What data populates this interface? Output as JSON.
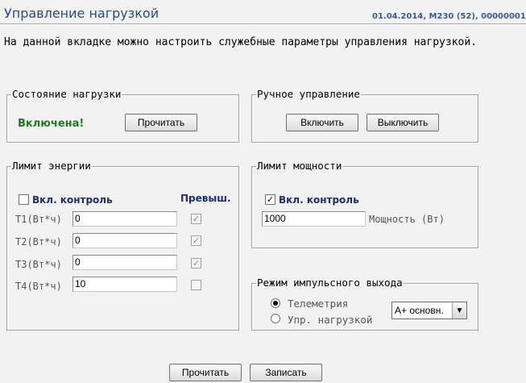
{
  "header": {
    "title": "Управление нагрузкой",
    "info": "01.04.2014, M230 (52), 00000001"
  },
  "description": "На данной вкладке можно настроить служебные параметры управления нагрузкой.",
  "load_state": {
    "legend": "Состояние нагрузки",
    "status": "Включена!",
    "read_button": "Прочитать"
  },
  "manual": {
    "legend": "Ручное управление",
    "on_button": "Включить",
    "off_button": "Выключить"
  },
  "energy_limit": {
    "legend": "Лимит энергии",
    "control_label": "Вкл. контроль",
    "control_checked": false,
    "exceeded_header": "Превыш.",
    "rows": [
      {
        "label": "T1(Вт*ч)",
        "value": "0",
        "exceeded": true
      },
      {
        "label": "T2(Вт*ч)",
        "value": "0",
        "exceeded": true
      },
      {
        "label": "T3(Вт*ч)",
        "value": "0",
        "exceeded": true
      },
      {
        "label": "T4(Вт*ч)",
        "value": "10",
        "exceeded": false
      }
    ]
  },
  "power_limit": {
    "legend": "Лимит мощности",
    "control_label": "Вкл. контроль",
    "control_checked": true,
    "value": "1000",
    "unit_label": "Мощность (Вт)"
  },
  "pulse_output": {
    "legend": "Режим импульсного выхода",
    "options": [
      "Телеметрия",
      "Упр. нагрузкой"
    ],
    "selected_option": 0,
    "select_value": "А+ основн."
  },
  "footer": {
    "read_button": "Прочитать",
    "write_button": "Записать"
  },
  "icons": {
    "check": "✓",
    "dropdown": "▼"
  },
  "colors": {
    "title": "#264c88",
    "status_on": "#217a21",
    "label_blue": "#1b2f6e"
  }
}
